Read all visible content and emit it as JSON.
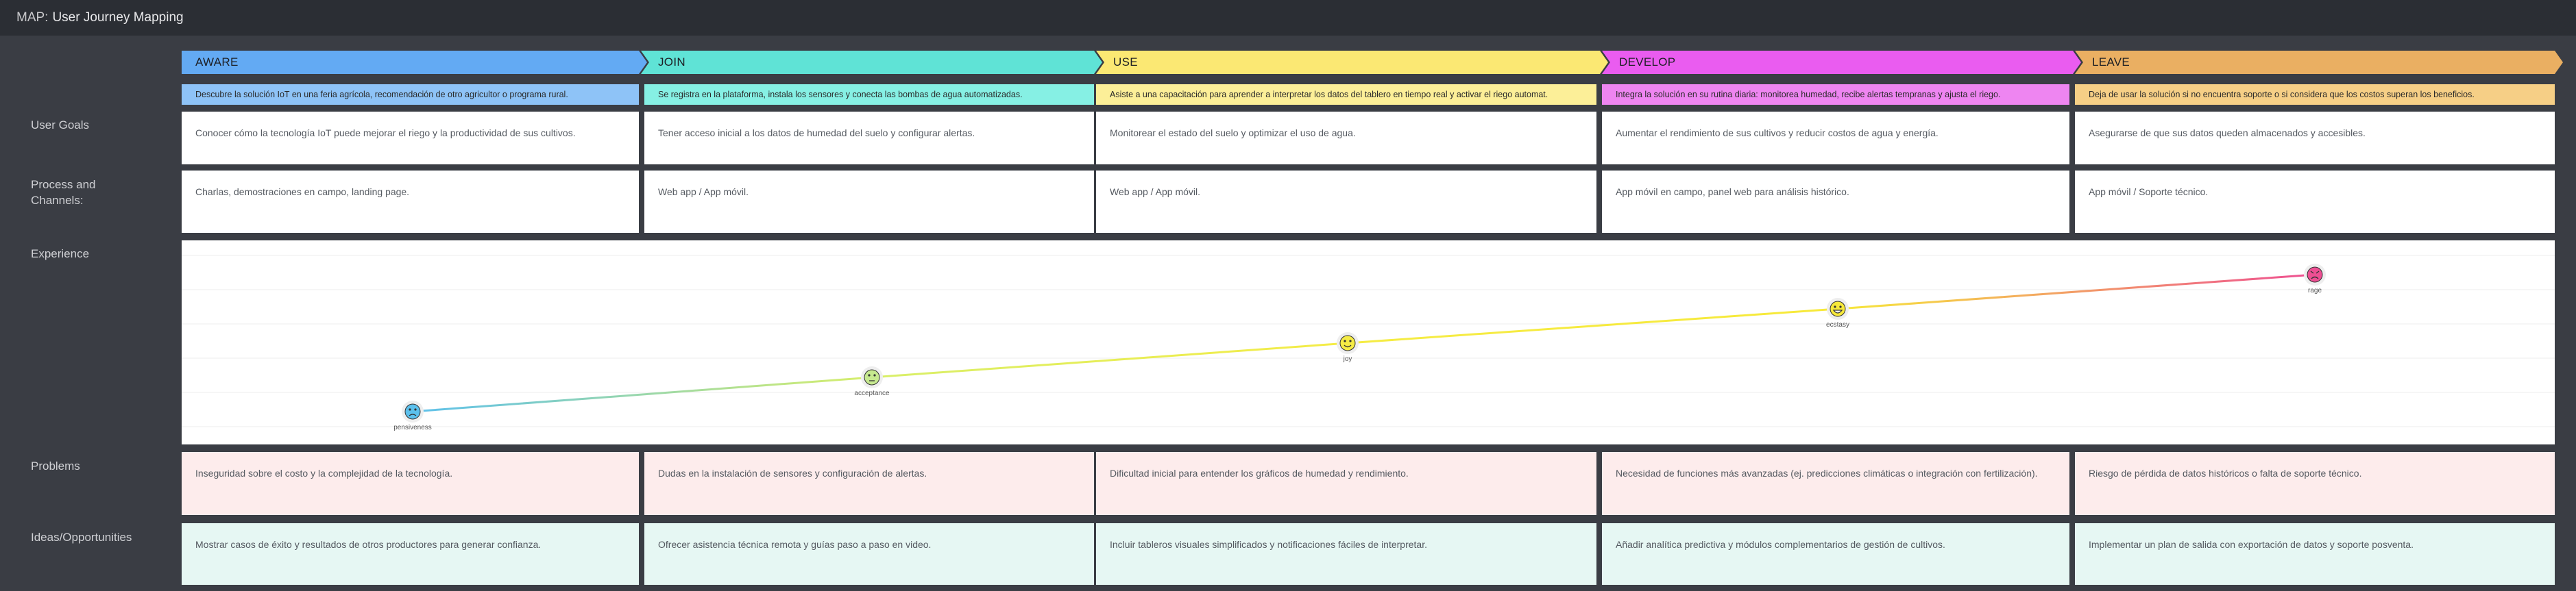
{
  "header": {
    "prefix": "MAP:",
    "title": "User Journey Mapping"
  },
  "row_labels": {
    "goals": "User Goals",
    "process": "Process and Channels:",
    "experience": "Experience",
    "problems": "Problems",
    "ideas": "Ideas/Opportunities"
  },
  "stages": [
    {
      "name": "AWARE",
      "color": "#63aaf3",
      "desc_color": "#8ec3f7",
      "desc": "Descubre la solución IoT en una feria agrícola, recomendación de otro agricultor o programa rural.",
      "goal": "Conocer cómo la tecnología IoT puede mejorar el riego y la productividad de sus cultivos.",
      "process": "Charlas, demostraciones en campo, landing page.",
      "problem": "Inseguridad sobre el costo y la complejidad de la tecnología.",
      "idea": "Mostrar casos de éxito y resultados de otros productores para generar confianza."
    },
    {
      "name": "JOIN",
      "color": "#5fe3d6",
      "desc_color": "#86f0e4",
      "desc": "Se registra en la plataforma, instala los sensores y conecta las bombas de agua automatizadas.",
      "goal": "Tener acceso inicial a los datos de humedad del suelo y configurar alertas.",
      "process": "Web app / App móvil.",
      "problem": "Dudas en la instalación de sensores y configuración de alertas.",
      "idea": "Ofrecer asistencia técnica remota y guías paso a paso en video."
    },
    {
      "name": "USE",
      "color": "#fbe873",
      "desc_color": "#fcef98",
      "desc": "Asiste a una capacitación para aprender a interpretar los datos del tablero en tiempo real y activar el riego automat.",
      "goal": "Monitorear el estado del suelo y optimizar el uso de agua.",
      "process": "Web app / App móvil.",
      "problem": "Dificultad inicial para entender los gráficos de humedad y rendimiento.",
      "idea": "Incluir tableros visuales simplificados y notificaciones fáciles de interpretar."
    },
    {
      "name": "DEVELOP",
      "color": "#ea5cf0",
      "desc_color": "#ee85f1",
      "desc": "Integra la solución en su rutina diaria: monitorea humedad, recibe alertas tempranas y ajusta el riego.",
      "goal": "Aumentar el rendimiento de sus cultivos y reducir costos de agua y energía.",
      "process": "App móvil en campo, panel web para análisis histórico.",
      "problem": "Necesidad de funciones más avanzadas (ej. predicciones climáticas o integración con fertilización).",
      "idea": "Añadir analítica predictiva y módulos complementarios de gestión de cultivos."
    },
    {
      "name": "LEAVE",
      "color": "#eaaf62",
      "desc_color": "#f6cf86",
      "desc": "Deja de usar la solución si no encuentra soporte o si considera que los costos superan los beneficios.",
      "goal": "Asegurarse de que sus datos queden almacenados y accesibles.",
      "process": "App móvil / Soporte técnico.",
      "problem": "Riesgo de pérdida de datos históricos o falta de soporte técnico.",
      "idea": "Implementar un plan de salida con exportación de datos y soporte posventa."
    }
  ],
  "experience": {
    "levels": 6,
    "points": [
      {
        "emotion": "pensiveness",
        "stage": 0,
        "level": 1,
        "face_color": "#5cc0ec",
        "face": "sad"
      },
      {
        "emotion": "acceptance",
        "stage": 1,
        "level": 2,
        "face_color": "#c6e98f",
        "face": "worried"
      },
      {
        "emotion": "joy",
        "stage": 2,
        "level": 3,
        "face_color": "#f5ec45",
        "face": "smile"
      },
      {
        "emotion": "ecstasy",
        "stage": 3,
        "level": 4,
        "face_color": "#f7e93a",
        "face": "grin"
      },
      {
        "emotion": "rage",
        "stage": 4,
        "level": 5,
        "face_color": "#ee4f93",
        "face": "angry"
      }
    ]
  }
}
